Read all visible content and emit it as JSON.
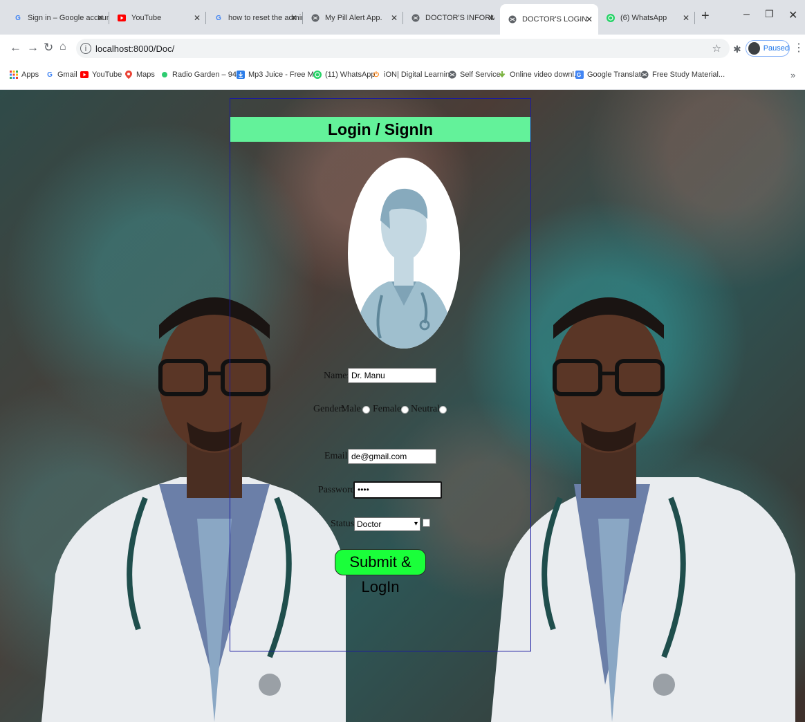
{
  "tabs": [
    {
      "label": "Sign in – Google account",
      "icon": "google-icon",
      "active": false
    },
    {
      "label": "YouTube",
      "icon": "youtube-icon",
      "active": false
    },
    {
      "label": "how to reset the admin p",
      "icon": "google-icon",
      "active": false
    },
    {
      "label": "My Pill Alert App.",
      "icon": "globe-icon",
      "active": false
    },
    {
      "label": "DOCTOR'S INFORMATIC",
      "icon": "globe-icon",
      "active": false
    },
    {
      "label": "DOCTOR'S LOGIN",
      "icon": "globe-icon",
      "active": true
    },
    {
      "label": "(6) WhatsApp",
      "icon": "whatsapp-icon",
      "active": false
    }
  ],
  "toolbar": {
    "url": "localhost:8000/Doc/",
    "profile_status": "Paused"
  },
  "bookmarks": [
    {
      "label": "Apps",
      "icon": "apps-grid-icon"
    },
    {
      "label": "Gmail",
      "icon": "google-icon"
    },
    {
      "label": "YouTube",
      "icon": "youtube-icon"
    },
    {
      "label": "Maps",
      "icon": "maps-icon"
    },
    {
      "label": "Radio Garden – 94....",
      "icon": "radio-garden-icon"
    },
    {
      "label": "Mp3 Juice - Free M...",
      "icon": "download-icon"
    },
    {
      "label": "(11) WhatsApp",
      "icon": "whatsapp-icon"
    },
    {
      "label": "iON| Digital Learning",
      "icon": "power-icon"
    },
    {
      "label": "Self Service",
      "icon": "globe-icon"
    },
    {
      "label": "Online video downl...",
      "icon": "download-arrow-icon"
    },
    {
      "label": "Google Translate",
      "icon": "translate-icon"
    },
    {
      "label": "Free Study Material...",
      "icon": "globe-icon"
    }
  ],
  "form": {
    "title": "Login / SignIn",
    "name_label": "Name:",
    "name_value": "Dr. Manu",
    "gender_label": "Gender:",
    "gender_options": [
      "Male",
      "Female",
      "Neutral"
    ],
    "email_label": "Email:",
    "email_value": "de@gmail.com",
    "password_label": "Password:",
    "password_value": "••••",
    "status_label": "Status:",
    "status_value": "Doctor",
    "submit_label": "Submit & LogIn"
  },
  "colors": {
    "title_bar": "#63f29a",
    "submit_button": "#1aff3a",
    "card_border": "#1a1aa0"
  }
}
